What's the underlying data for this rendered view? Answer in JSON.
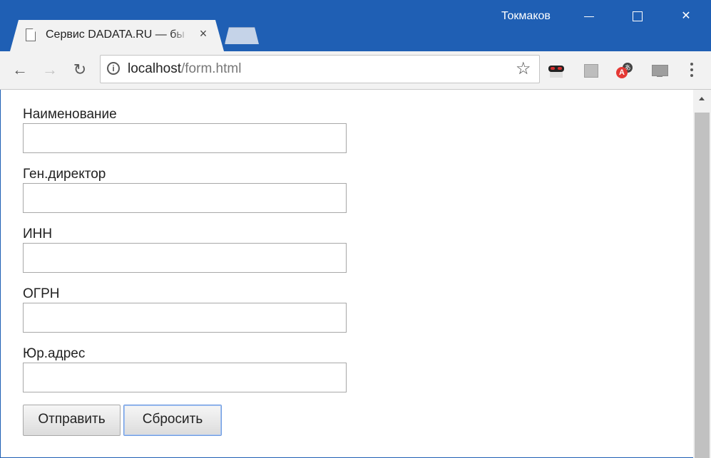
{
  "window": {
    "profile_name": "Токмаков",
    "controls": {
      "minimize": "",
      "maximize": "",
      "close": "✕"
    }
  },
  "tab": {
    "title": "Сервис DADATA.RU — бы",
    "close_label": "×",
    "icon": "document-icon"
  },
  "toolbar": {
    "back_glyph": "←",
    "forward_glyph": "→",
    "reload_glyph": "↻",
    "url_host": "localhost",
    "url_path": "/form.html",
    "star_glyph": "☆",
    "info_glyph": "i",
    "extensions": [
      "incognito-mask-icon",
      "reader-icon",
      "translate-icon",
      "cast-icon"
    ]
  },
  "form": {
    "fields": [
      {
        "label": "Наименование",
        "value": ""
      },
      {
        "label": "Ген.директор",
        "value": ""
      },
      {
        "label": "ИНН",
        "value": ""
      },
      {
        "label": "ОГРН",
        "value": ""
      },
      {
        "label": "Юр.адрес",
        "value": ""
      }
    ],
    "submit_label": "Отправить",
    "reset_label": "Сбросить"
  },
  "colors": {
    "titlebar": "#1f5fb4",
    "toolbar": "#f2f2f2",
    "focus_ring": "#6d9ae0"
  }
}
